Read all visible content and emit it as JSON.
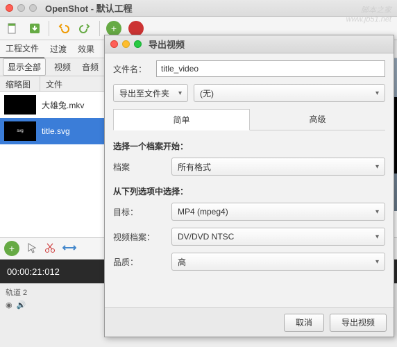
{
  "window": {
    "title": "OpenShot - 默认工程",
    "watermark": "脚本之家\nwww.jb51.net"
  },
  "tabs": {
    "project": "工程文件",
    "transition": "过渡",
    "effect": "效果"
  },
  "subrow": {
    "show_all": "显示全部",
    "video": "视频",
    "audio": "音频"
  },
  "thumb_header": {
    "col1": "缩略图",
    "col2": "文件"
  },
  "files": [
    {
      "name": "大雄兔.mkv",
      "selected": false
    },
    {
      "name": "title.svg",
      "selected": true
    }
  ],
  "timeline": {
    "timecode": "00:00:21:012"
  },
  "track": {
    "label": "轨道 2"
  },
  "dialog": {
    "title": "导出视频",
    "filename_label": "文件名：",
    "filename_value": "title_video",
    "export_to_label": "导出至文件夹",
    "dest_value": "(无)",
    "tabs": {
      "simple": "简单",
      "advanced": "高级"
    },
    "section1": {
      "title": "选择一个档案开始：",
      "archive_label": "档案",
      "archive_value": "所有格式"
    },
    "section2": {
      "title": "从下列选项中选择：",
      "target_label": "目标：",
      "target_value": "MP4 (mpeg4)",
      "video_label": "视频档案：",
      "video_value": "DV/DVD NTSC",
      "quality_label": "品质：",
      "quality_value": "高"
    },
    "buttons": {
      "cancel": "取消",
      "export": "导出视频"
    }
  }
}
